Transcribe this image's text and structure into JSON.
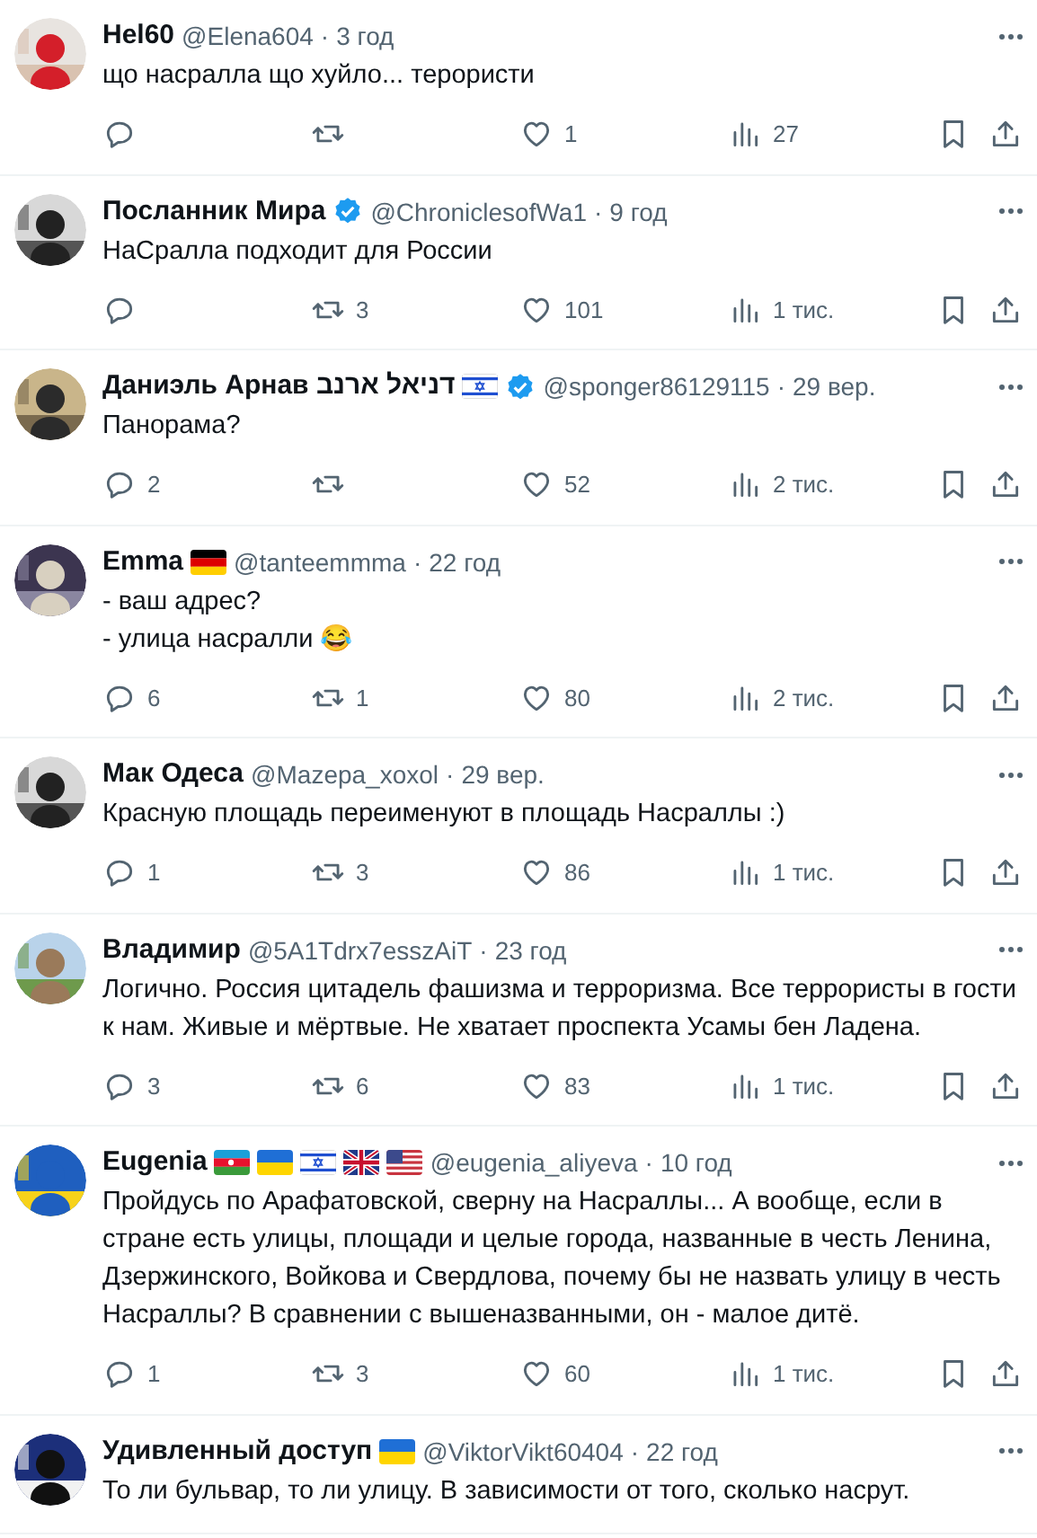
{
  "replies": [
    {
      "name": "Hel60",
      "handle": "@Elena604",
      "dot": "·",
      "time": "3 год",
      "verified": false,
      "text": [
        "що насралла що хуйло... терористи"
      ],
      "stats": {
        "likes": "1",
        "views": "27"
      }
    },
    {
      "name": "Посланник Мира",
      "handle": "@ChroniclesofWa1",
      "dot": "·",
      "time": "9 год",
      "verified": true,
      "text": [
        "НаСралла подходит для России"
      ],
      "stats": {
        "reposts": "3",
        "likes": "101",
        "views": "1 тис."
      }
    },
    {
      "name": "Даниэль Арнав דניאל ארנב",
      "handle": "@sponger86129115",
      "dot": "·",
      "time": "29 вер.",
      "verified": true,
      "flags": [
        {
          "kind": "israel"
        }
      ],
      "text": [
        "Панорама?"
      ],
      "stats": {
        "replies": "2",
        "likes": "52",
        "views": "2 тис."
      }
    },
    {
      "name": "Emma",
      "handle": "@tanteemmma",
      "dot": "·",
      "time": "22 год",
      "verified": false,
      "flags": [
        {
          "kind": "germany"
        }
      ],
      "text": [
        "- ваш адрес?",
        "- улица насралли 😂"
      ],
      "stats": {
        "replies": "6",
        "reposts": "1",
        "likes": "80",
        "views": "2 тис."
      }
    },
    {
      "name": "Мак Одеса",
      "handle": "@Mazepa_xoxol",
      "dot": "·",
      "time": "29 вер.",
      "verified": false,
      "text": [
        "Красную площадь переименуют в площадь Насраллы :)"
      ],
      "stats": {
        "replies": "1",
        "reposts": "3",
        "likes": "86",
        "views": "1 тис."
      }
    },
    {
      "name": "Владимир",
      "handle": "@5A1Tdrx7esszAiT",
      "dot": "·",
      "time": "23 год",
      "verified": false,
      "text": [
        "Логично. Россия цитадель фашизма и терроризма. Все террористы в гости к нам. Живые и мёртвые. Не хватает проспекта Усамы бен Ладена."
      ],
      "stats": {
        "replies": "3",
        "reposts": "6",
        "likes": "83",
        "views": "1 тис."
      }
    },
    {
      "name": "Eugenia",
      "handle": "@eugenia_aliyeva",
      "dot": "·",
      "time": "10 год",
      "verified": false,
      "flags": [
        {
          "kind": "azerbaijan"
        },
        {
          "kind": "ukraine"
        },
        {
          "kind": "israel"
        },
        {
          "kind": "uk"
        },
        {
          "kind": "usa"
        }
      ],
      "text": [
        "Пройдусь по Арафатовской, сверну на Насраллы... А вообще, если в стране есть улицы, площади и целые города, названные в честь Ленина, Дзержинского, Войкова и Свердлова, почему бы не назвать улицу в честь Насраллы? В сравнении с вышеназванными, он - малое дитё."
      ],
      "stats": {
        "replies": "1",
        "reposts": "3",
        "likes": "60",
        "views": "1 тис."
      }
    },
    {
      "name": "Удивленный доступ",
      "handle": "@ViktorVikt60404",
      "dot": "·",
      "time": "22 год",
      "verified": false,
      "flags": [
        {
          "kind": "ukraine"
        }
      ],
      "text": [
        "То ли бульвар, то ли улицу. В зависимости от того, сколько насрут."
      ]
    }
  ]
}
